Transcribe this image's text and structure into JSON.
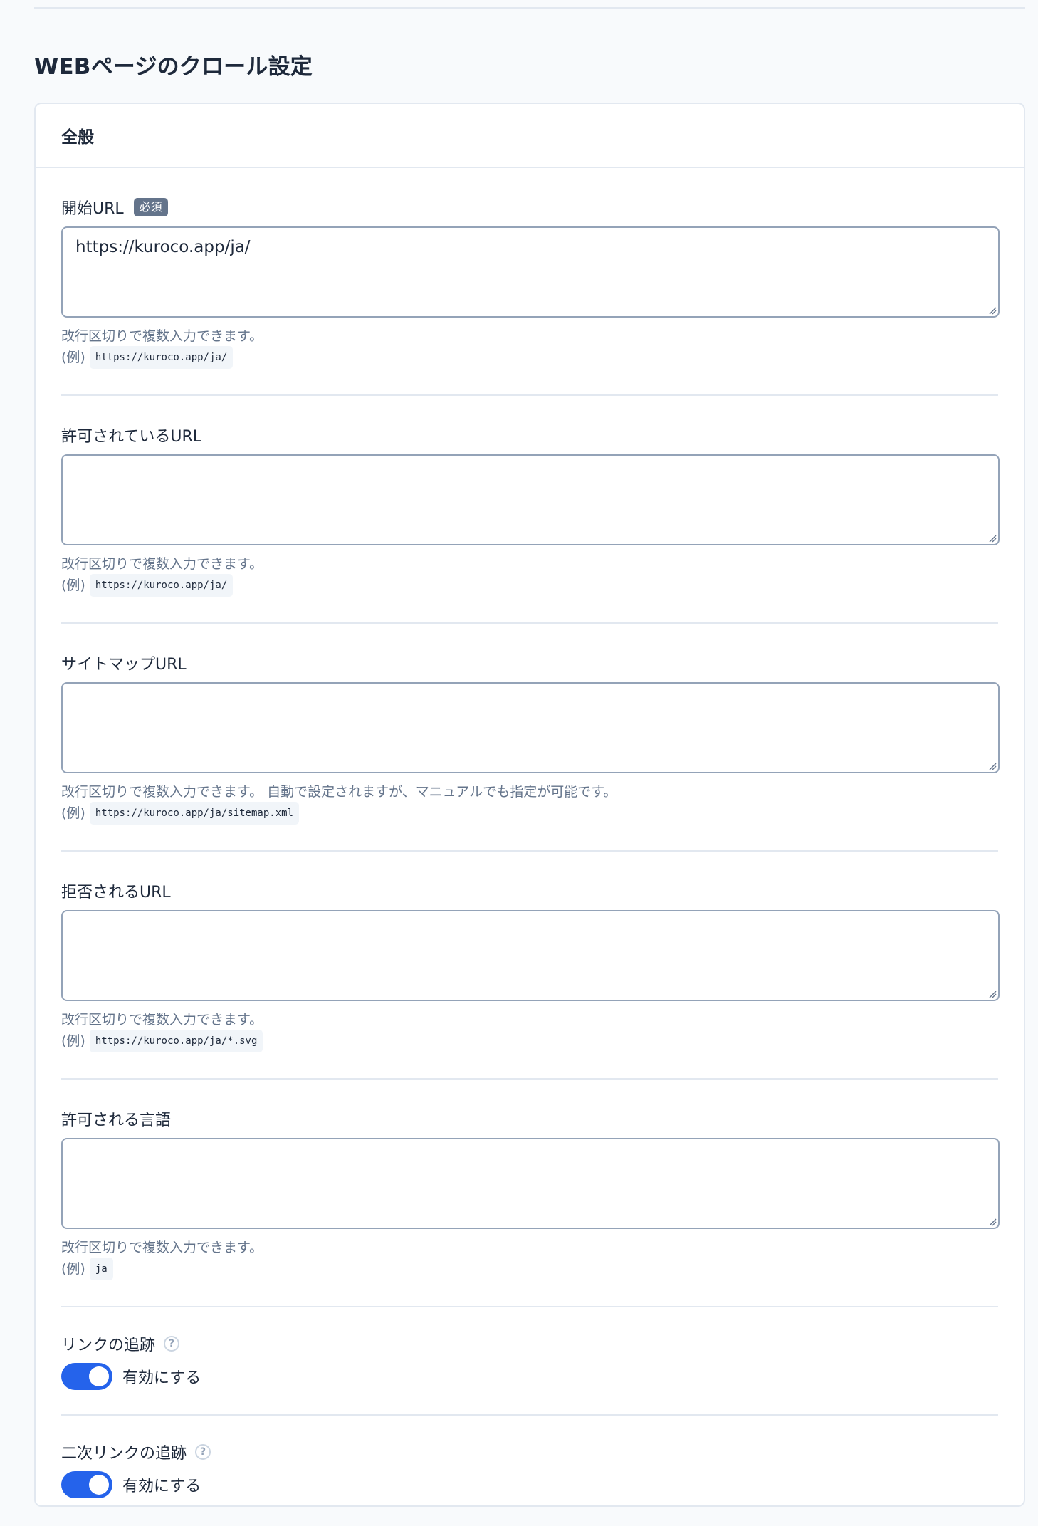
{
  "page": {
    "title": "WEBページのクロール設定"
  },
  "card": {
    "header": "全般"
  },
  "fields": [
    {
      "label": "開始URL",
      "required_badge": "必須",
      "value": "https://kuroco.app/ja/",
      "hint": "改行区切りで複数入力できます。",
      "example_prefix": "(例)",
      "example": "https://kuroco.app/ja/"
    },
    {
      "label": "許可されているURL",
      "value": "",
      "hint": "改行区切りで複数入力できます。",
      "example_prefix": "(例)",
      "example": "https://kuroco.app/ja/"
    },
    {
      "label": "サイトマップURL",
      "value": "",
      "hint": "改行区切りで複数入力できます。 自動で設定されますが、マニュアルでも指定が可能です。",
      "example_prefix": "(例)",
      "example": "https://kuroco.app/ja/sitemap.xml"
    },
    {
      "label": "拒否されるURL",
      "value": "",
      "hint": "改行区切りで複数入力できます。",
      "example_prefix": "(例)",
      "example": "https://kuroco.app/ja/*.svg"
    },
    {
      "label": "許可される言語",
      "value": "",
      "hint": "改行区切りで複数入力できます。",
      "example_prefix": "(例)",
      "example": "ja"
    }
  ],
  "toggles": [
    {
      "label": "リンクの追跡",
      "help": "?",
      "enabled": true,
      "text": "有効にする"
    },
    {
      "label": "二次リンクの追跡",
      "help": "?",
      "enabled": true,
      "text": "有効にする"
    }
  ],
  "colors": {
    "accent": "#2563eb",
    "badge": "#64748b",
    "border": "#e2e8f0"
  }
}
